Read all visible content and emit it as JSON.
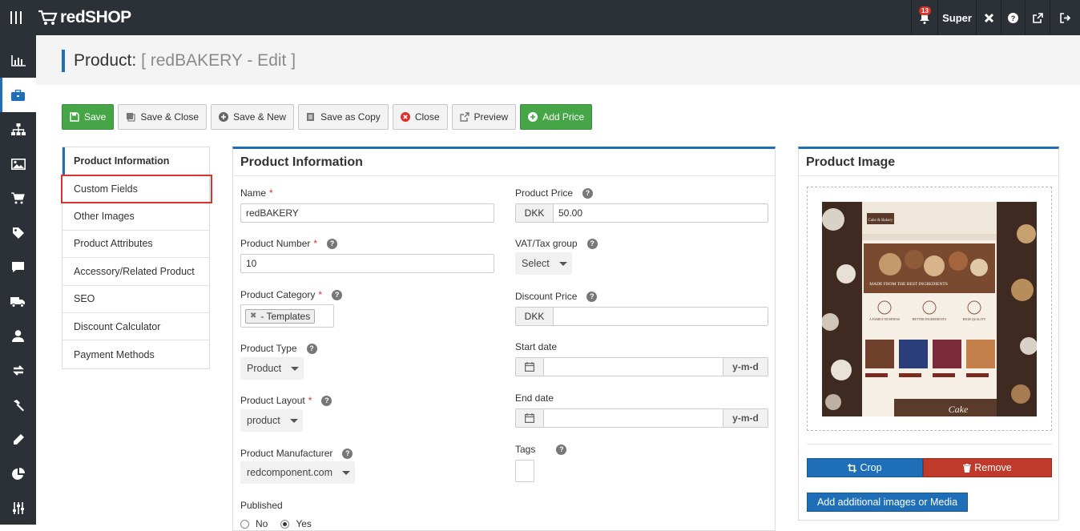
{
  "app": {
    "brand": "redSHOP"
  },
  "header": {
    "notification_count": "13",
    "user_label": "Super"
  },
  "page": {
    "title_prefix": "Product:",
    "title_sub": "[ redBAKERY - Edit ]"
  },
  "toolbar": {
    "save": "Save",
    "save_close": "Save & Close",
    "save_new": "Save & New",
    "save_copy": "Save as Copy",
    "close": "Close",
    "preview": "Preview",
    "add_price": "Add Price"
  },
  "tabs": [
    {
      "label": "Product Information"
    },
    {
      "label": "Custom Fields"
    },
    {
      "label": "Other Images"
    },
    {
      "label": "Product Attributes"
    },
    {
      "label": "Accessory/Related Product"
    },
    {
      "label": "SEO"
    },
    {
      "label": "Discount Calculator"
    },
    {
      "label": "Payment Methods"
    }
  ],
  "info": {
    "heading": "Product Information",
    "name_label": "Name",
    "name_value": "redBAKERY",
    "number_label": "Product Number",
    "number_value": "10",
    "category_label": "Product Category",
    "category_tag": "- Templates",
    "type_label": "Product Type",
    "type_value": "Product",
    "layout_label": "Product Layout",
    "layout_value": "product",
    "manufacturer_label": "Product Manufacturer",
    "manufacturer_value": "redcomponent.com",
    "published_label": "Published",
    "published_no": "No",
    "published_yes": "Yes",
    "price_label": "Product Price",
    "price_currency": "DKK",
    "price_value": "50.00",
    "vat_label": "VAT/Tax group",
    "vat_value": "Select",
    "discount_label": "Discount Price",
    "discount_currency": "DKK",
    "start_label": "Start date",
    "start_format": "y-m-d",
    "end_label": "End date",
    "end_format": "y-m-d",
    "tags_label": "Tags",
    "required_mark": "*",
    "help_mark": "?"
  },
  "image_panel": {
    "heading": "Product Image",
    "crop": "Crop",
    "remove": "Remove",
    "add_media": "Add additional images or Media",
    "preview_texts": {
      "sign": "Cake & Bakery",
      "banner": "MADE FROM THE BEST INGREDIENTS",
      "feature1": "A FAMILY BUSINESS",
      "feature2": "BETTER INGREDIENTS",
      "feature3": "HIGH QUALITY",
      "cake_sign": "Cake"
    }
  }
}
